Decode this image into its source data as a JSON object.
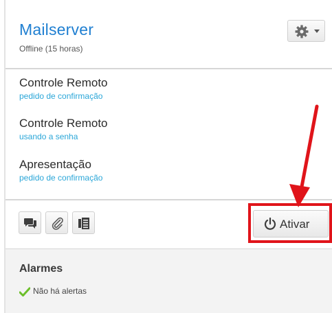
{
  "device": {
    "name": "Mailserver",
    "status": "Offline (15 horas)"
  },
  "functions": [
    {
      "name": "Controle Remoto",
      "status": "pedido de confirmação"
    },
    {
      "name": "Controle Remoto",
      "status": "usando a senha"
    },
    {
      "name": "Apresentação",
      "status": "pedido de confirmação"
    }
  ],
  "toolbar": {
    "chat_icon": "chat-icon",
    "attach_icon": "paperclip-icon",
    "files_icon": "file-list-icon",
    "activate_icon": "power-icon",
    "activate_label": "Ativar"
  },
  "alarms": {
    "title": "Alarmes",
    "status_icon": "checkmark-icon",
    "status_text": "Não há alertas"
  },
  "colors": {
    "title": "#1f7fd1",
    "status_link": "#2aa6d8",
    "highlight": "#e0141a",
    "check": "#6cbf2a"
  }
}
